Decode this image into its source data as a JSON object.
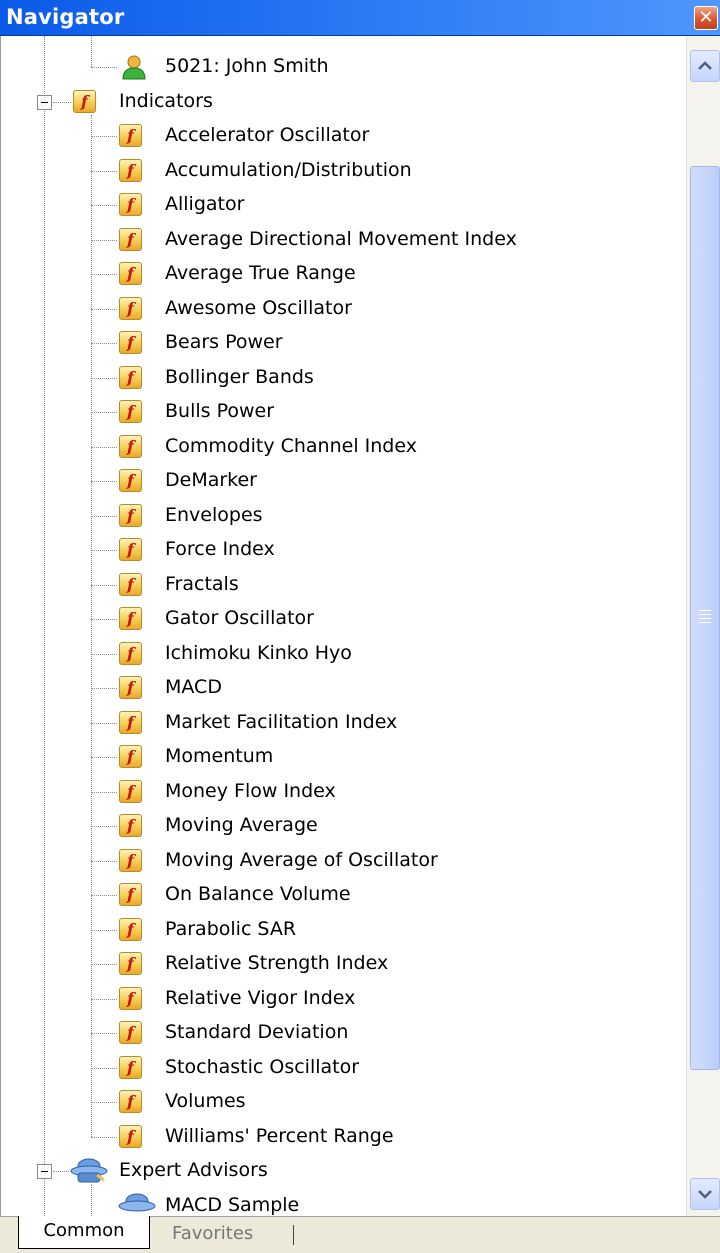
{
  "window": {
    "title": "Navigator",
    "close_glyph": "✕"
  },
  "tree": {
    "account": {
      "label": "5021: John Smith",
      "icon": "user-icon"
    },
    "indicators": {
      "label": "Indicators",
      "icon": "function-icon",
      "icon_glyph": "f",
      "expanded": true,
      "items": [
        "Accelerator Oscillator",
        "Accumulation/Distribution",
        "Alligator",
        "Average Directional Movement Index",
        "Average True Range",
        "Awesome Oscillator",
        "Bears Power",
        "Bollinger Bands",
        "Bulls Power",
        "Commodity Channel Index",
        "DeMarker",
        "Envelopes",
        "Force Index",
        "Fractals",
        "Gator Oscillator",
        "Ichimoku Kinko Hyo",
        "MACD",
        "Market Facilitation Index",
        "Momentum",
        "Money Flow Index",
        "Moving Average",
        "Moving Average of Oscillator",
        "On Balance Volume",
        "Parabolic SAR",
        "Relative Strength Index",
        "Relative Vigor Index",
        "Standard Deviation",
        "Stochastic Oscillator",
        "Volumes",
        "Williams' Percent Range"
      ]
    },
    "expert_advisors": {
      "label": "Expert Advisors",
      "icon": "expert-advisor-icon",
      "expanded": true,
      "items": [
        "MACD Sample"
      ]
    }
  },
  "scrollbar": {
    "up_glyph": "▲",
    "down_glyph": "▼"
  },
  "tabs": {
    "common": "Common",
    "favorites": "Favorites",
    "active": "Common"
  }
}
